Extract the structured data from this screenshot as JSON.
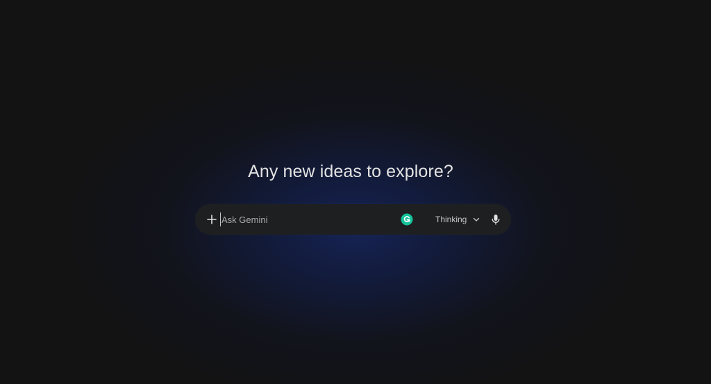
{
  "greeting": "Any new ideas to explore?",
  "prompt": {
    "placeholder": "Ask Gemini",
    "value": ""
  },
  "mode": {
    "label": "Thinking"
  },
  "icons": {
    "add": "plus-icon",
    "extension": "grammarly-icon",
    "dropdown": "chevron-down-icon",
    "voice": "microphone-icon"
  },
  "colors": {
    "background": "#131314",
    "glow": "#162458",
    "input_bar": "#1e1f20",
    "text": "#e3e3e3",
    "muted_text": "#c4c7c5",
    "grammarly": "#15c39a"
  }
}
